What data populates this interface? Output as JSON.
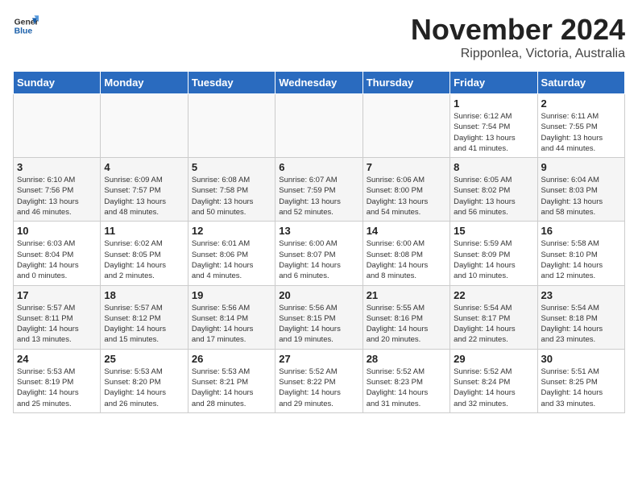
{
  "header": {
    "logo_general": "General",
    "logo_blue": "Blue",
    "month_title": "November 2024",
    "location": "Ripponlea, Victoria, Australia"
  },
  "calendar": {
    "days_of_week": [
      "Sunday",
      "Monday",
      "Tuesday",
      "Wednesday",
      "Thursday",
      "Friday",
      "Saturday"
    ],
    "weeks": [
      [
        {
          "day": "",
          "info": ""
        },
        {
          "day": "",
          "info": ""
        },
        {
          "day": "",
          "info": ""
        },
        {
          "day": "",
          "info": ""
        },
        {
          "day": "",
          "info": ""
        },
        {
          "day": "1",
          "info": "Sunrise: 6:12 AM\nSunset: 7:54 PM\nDaylight: 13 hours\nand 41 minutes."
        },
        {
          "day": "2",
          "info": "Sunrise: 6:11 AM\nSunset: 7:55 PM\nDaylight: 13 hours\nand 44 minutes."
        }
      ],
      [
        {
          "day": "3",
          "info": "Sunrise: 6:10 AM\nSunset: 7:56 PM\nDaylight: 13 hours\nand 46 minutes."
        },
        {
          "day": "4",
          "info": "Sunrise: 6:09 AM\nSunset: 7:57 PM\nDaylight: 13 hours\nand 48 minutes."
        },
        {
          "day": "5",
          "info": "Sunrise: 6:08 AM\nSunset: 7:58 PM\nDaylight: 13 hours\nand 50 minutes."
        },
        {
          "day": "6",
          "info": "Sunrise: 6:07 AM\nSunset: 7:59 PM\nDaylight: 13 hours\nand 52 minutes."
        },
        {
          "day": "7",
          "info": "Sunrise: 6:06 AM\nSunset: 8:00 PM\nDaylight: 13 hours\nand 54 minutes."
        },
        {
          "day": "8",
          "info": "Sunrise: 6:05 AM\nSunset: 8:02 PM\nDaylight: 13 hours\nand 56 minutes."
        },
        {
          "day": "9",
          "info": "Sunrise: 6:04 AM\nSunset: 8:03 PM\nDaylight: 13 hours\nand 58 minutes."
        }
      ],
      [
        {
          "day": "10",
          "info": "Sunrise: 6:03 AM\nSunset: 8:04 PM\nDaylight: 14 hours\nand 0 minutes."
        },
        {
          "day": "11",
          "info": "Sunrise: 6:02 AM\nSunset: 8:05 PM\nDaylight: 14 hours\nand 2 minutes."
        },
        {
          "day": "12",
          "info": "Sunrise: 6:01 AM\nSunset: 8:06 PM\nDaylight: 14 hours\nand 4 minutes."
        },
        {
          "day": "13",
          "info": "Sunrise: 6:00 AM\nSunset: 8:07 PM\nDaylight: 14 hours\nand 6 minutes."
        },
        {
          "day": "14",
          "info": "Sunrise: 6:00 AM\nSunset: 8:08 PM\nDaylight: 14 hours\nand 8 minutes."
        },
        {
          "day": "15",
          "info": "Sunrise: 5:59 AM\nSunset: 8:09 PM\nDaylight: 14 hours\nand 10 minutes."
        },
        {
          "day": "16",
          "info": "Sunrise: 5:58 AM\nSunset: 8:10 PM\nDaylight: 14 hours\nand 12 minutes."
        }
      ],
      [
        {
          "day": "17",
          "info": "Sunrise: 5:57 AM\nSunset: 8:11 PM\nDaylight: 14 hours\nand 13 minutes."
        },
        {
          "day": "18",
          "info": "Sunrise: 5:57 AM\nSunset: 8:12 PM\nDaylight: 14 hours\nand 15 minutes."
        },
        {
          "day": "19",
          "info": "Sunrise: 5:56 AM\nSunset: 8:14 PM\nDaylight: 14 hours\nand 17 minutes."
        },
        {
          "day": "20",
          "info": "Sunrise: 5:56 AM\nSunset: 8:15 PM\nDaylight: 14 hours\nand 19 minutes."
        },
        {
          "day": "21",
          "info": "Sunrise: 5:55 AM\nSunset: 8:16 PM\nDaylight: 14 hours\nand 20 minutes."
        },
        {
          "day": "22",
          "info": "Sunrise: 5:54 AM\nSunset: 8:17 PM\nDaylight: 14 hours\nand 22 minutes."
        },
        {
          "day": "23",
          "info": "Sunrise: 5:54 AM\nSunset: 8:18 PM\nDaylight: 14 hours\nand 23 minutes."
        }
      ],
      [
        {
          "day": "24",
          "info": "Sunrise: 5:53 AM\nSunset: 8:19 PM\nDaylight: 14 hours\nand 25 minutes."
        },
        {
          "day": "25",
          "info": "Sunrise: 5:53 AM\nSunset: 8:20 PM\nDaylight: 14 hours\nand 26 minutes."
        },
        {
          "day": "26",
          "info": "Sunrise: 5:53 AM\nSunset: 8:21 PM\nDaylight: 14 hours\nand 28 minutes."
        },
        {
          "day": "27",
          "info": "Sunrise: 5:52 AM\nSunset: 8:22 PM\nDaylight: 14 hours\nand 29 minutes."
        },
        {
          "day": "28",
          "info": "Sunrise: 5:52 AM\nSunset: 8:23 PM\nDaylight: 14 hours\nand 31 minutes."
        },
        {
          "day": "29",
          "info": "Sunrise: 5:52 AM\nSunset: 8:24 PM\nDaylight: 14 hours\nand 32 minutes."
        },
        {
          "day": "30",
          "info": "Sunrise: 5:51 AM\nSunset: 8:25 PM\nDaylight: 14 hours\nand 33 minutes."
        }
      ]
    ]
  }
}
